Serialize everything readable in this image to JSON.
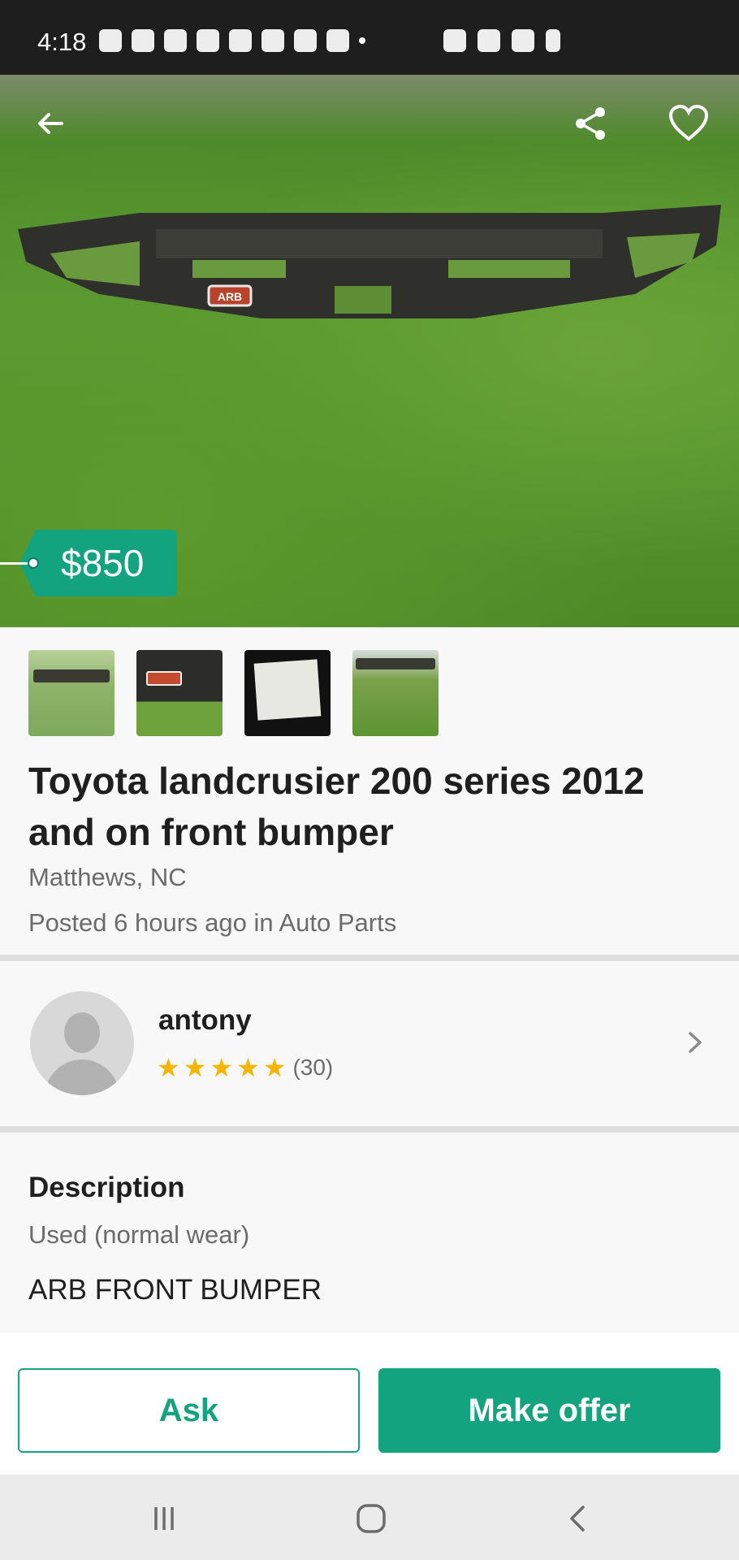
{
  "status_bar": {
    "time": "4:18"
  },
  "listing": {
    "price": "$850",
    "title": "Toyota landcrusier 200 series 2012 and on front bumper",
    "location": "Matthews, NC",
    "posted": "Posted 6 hours ago in Auto Parts",
    "hero_brand_plate": "ARB",
    "photo_count": 4
  },
  "seller": {
    "name": "antony",
    "rating_stars": 5,
    "rating_count": "(30)"
  },
  "description": {
    "heading": "Description",
    "condition": "Used (normal wear)",
    "body": "ARB FRONT BUMPER"
  },
  "actions": {
    "ask_label": "Ask",
    "offer_label": "Make offer"
  },
  "colors": {
    "accent": "#14a37f",
    "star": "#f7b500",
    "status_bar_bg": "#1e1e1e"
  },
  "icons": {
    "back": "arrow-left-icon",
    "share": "share-icon",
    "favorite": "heart-icon",
    "seller_open": "chevron-right-icon"
  }
}
